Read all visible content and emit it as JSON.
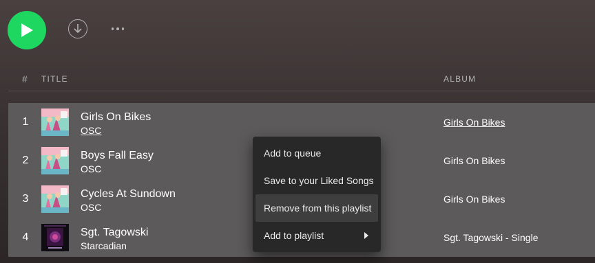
{
  "toolbar": {
    "play_icon": "play-icon",
    "download_icon": "download-circle-icon",
    "more_icon": "more-horizontal-icon"
  },
  "table_header": {
    "number": "#",
    "title": "TITLE",
    "album": "ALBUM"
  },
  "tracks": [
    {
      "number": "1",
      "title": "Girls On Bikes",
      "artist": "OSC",
      "album": "Girls On Bikes"
    },
    {
      "number": "2",
      "title": "Boys Fall Easy",
      "artist": "OSC",
      "album": "Girls On Bikes"
    },
    {
      "number": "3",
      "title": "Cycles At Sundown",
      "artist": "OSC",
      "album": "Girls On Bikes"
    },
    {
      "number": "4",
      "title": "Sgt. Tagowski",
      "artist": "Starcadian",
      "album": "Sgt. Tagowski - Single"
    }
  ],
  "context_menu": {
    "items": [
      {
        "label": "Add to queue"
      },
      {
        "label": "Save to your Liked Songs"
      },
      {
        "label": "Remove from this playlist"
      },
      {
        "label": "Add to playlist"
      }
    ]
  },
  "colors": {
    "accent": "#1ed760",
    "selected_rows": "#5c5a5a",
    "menu_bg": "#282828",
    "menu_hover": "#3e3e3e"
  }
}
